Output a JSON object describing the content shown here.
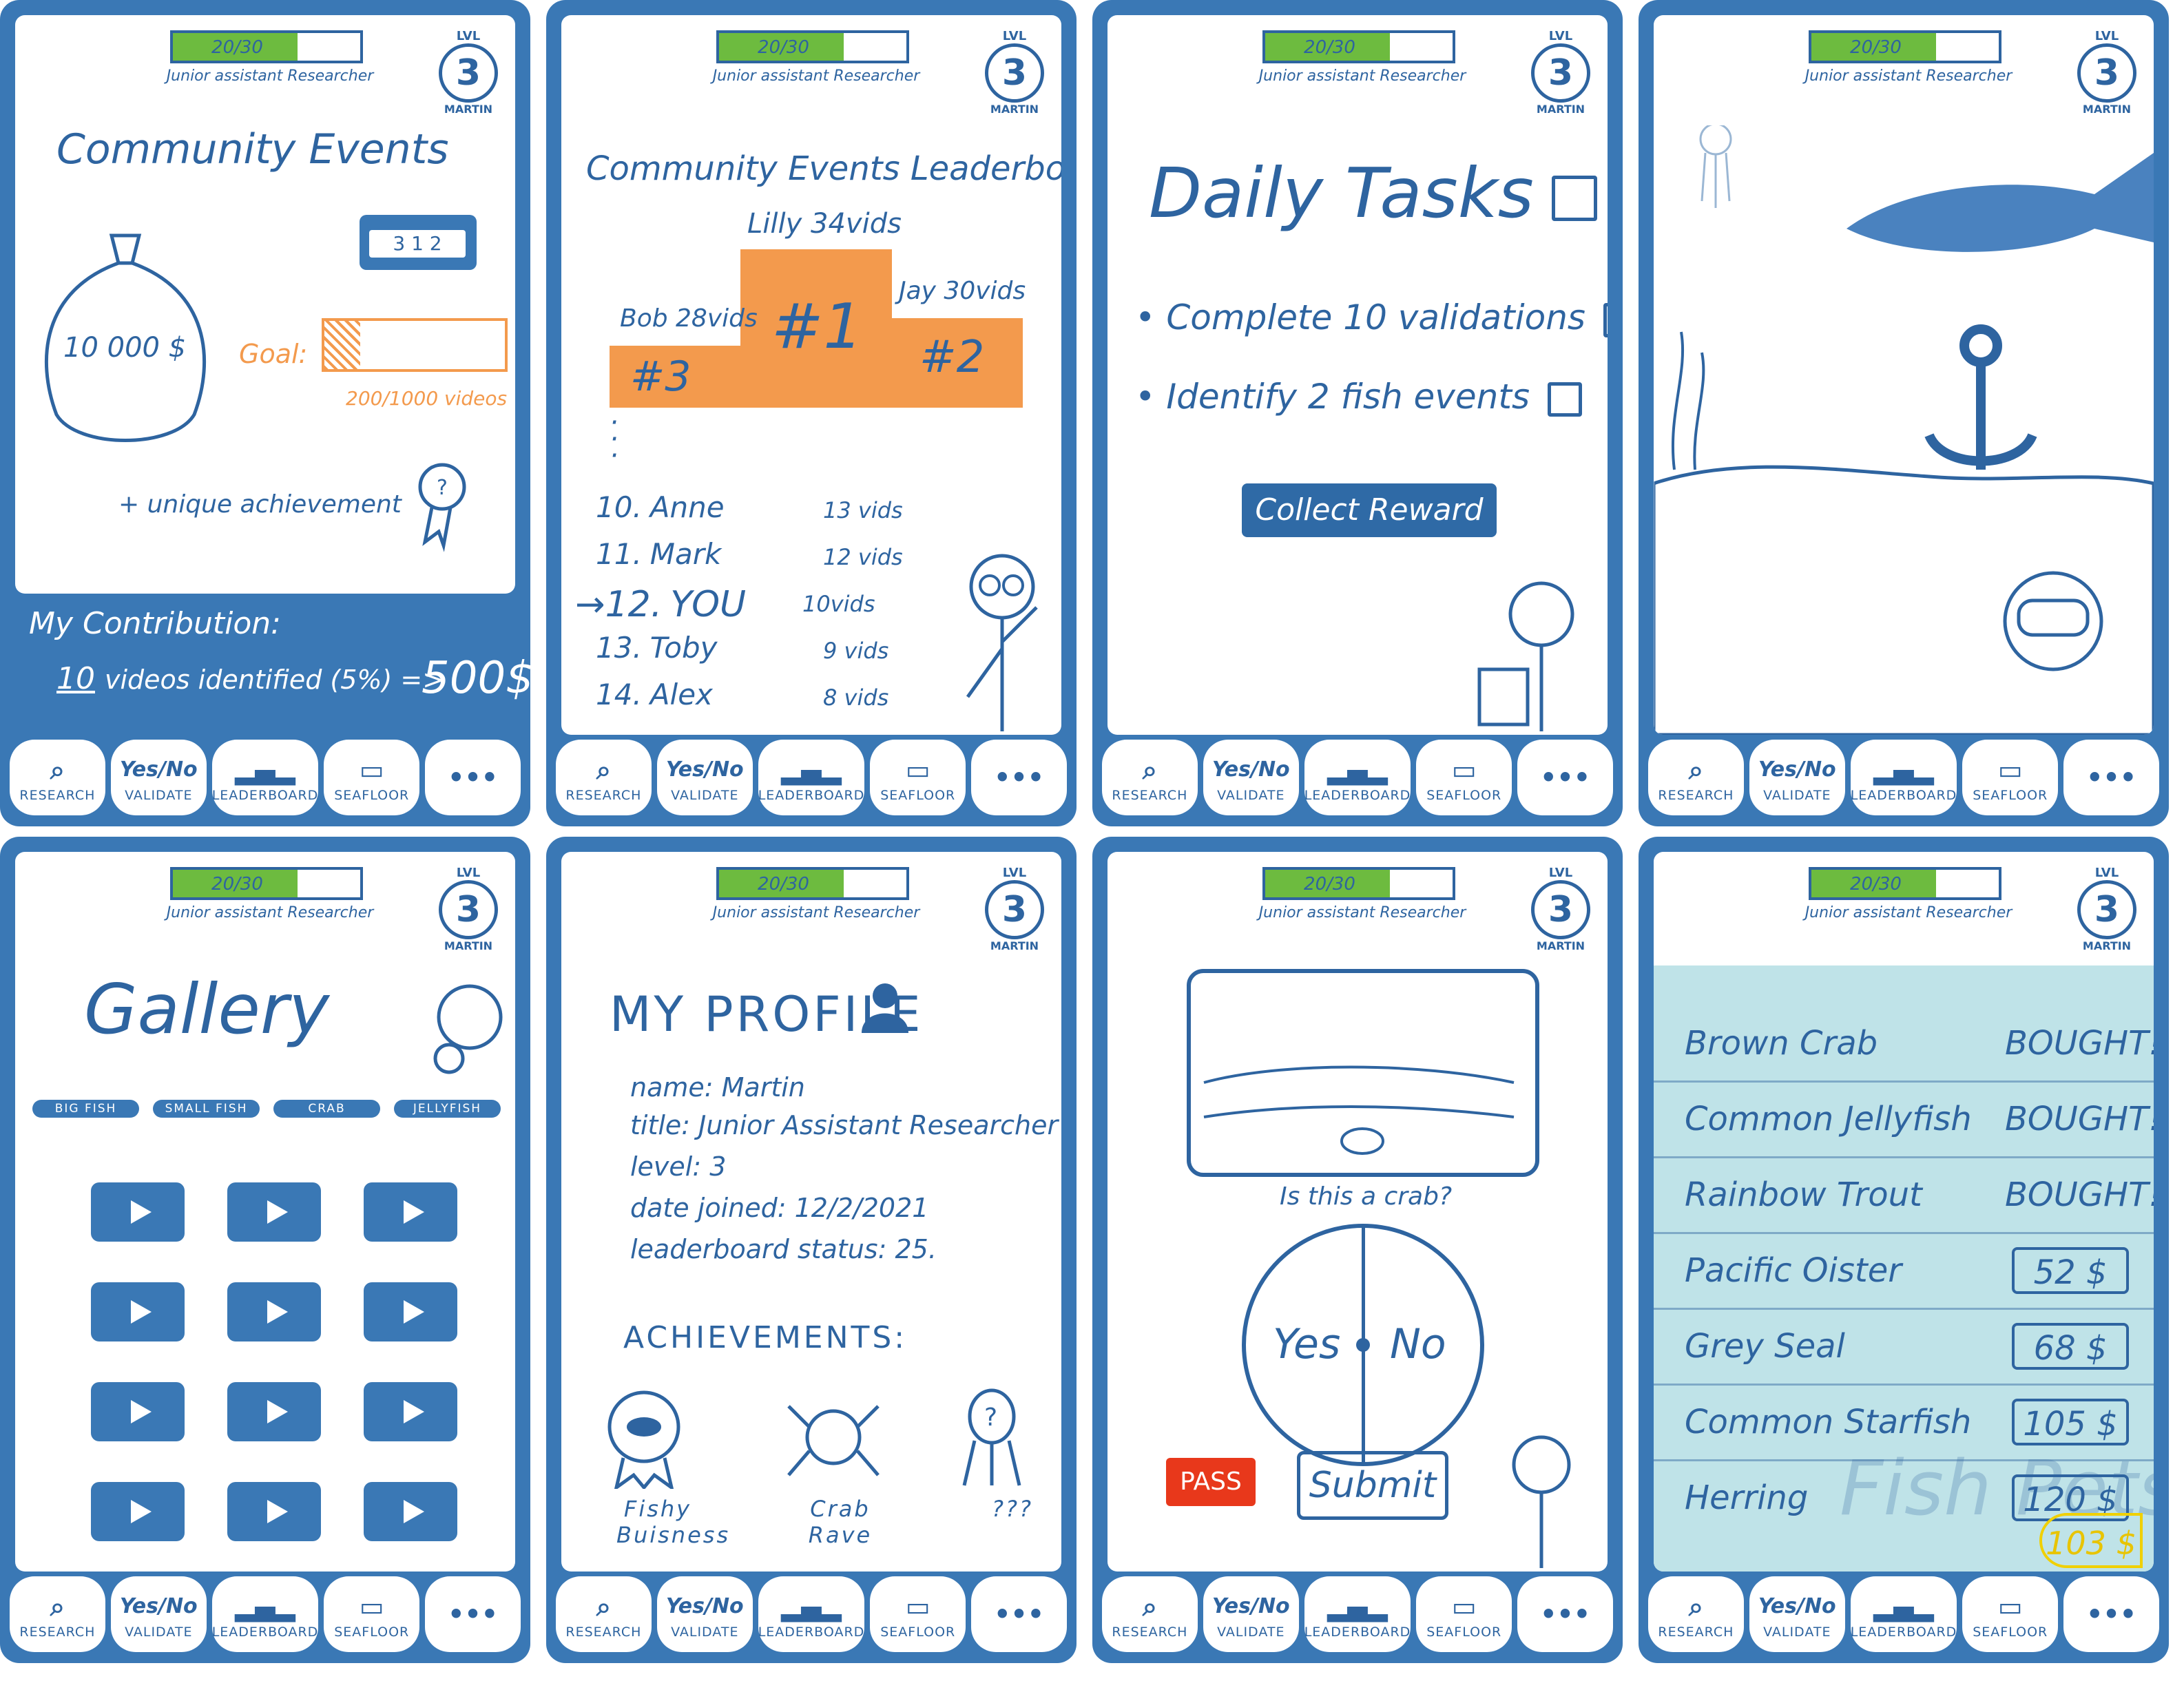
{
  "common": {
    "xp": "20/30",
    "xp_fraction": 0.667,
    "rank": "Junior assistant Researcher",
    "lvl_label": "LVL",
    "level": "3",
    "player": "MARTIN"
  },
  "nav": [
    {
      "icon": "search-icon",
      "label": "RESEARCH"
    },
    {
      "icon": "yes-no-icon",
      "label": "VALIDATE",
      "glyph": "Yes/No"
    },
    {
      "icon": "podium-icon",
      "label": "LEADERBOARD"
    },
    {
      "icon": "image-icon",
      "label": "SEAFLOOR"
    },
    {
      "icon": "more-icon",
      "label": ""
    }
  ],
  "screen1": {
    "title": "Community Events",
    "pool": "10 000 $",
    "goal_label": "Goal:",
    "goal_progress": "200/1000 videos",
    "goal_fraction": 0.2,
    "podium_badge": "3 1 2",
    "achievement": "+ unique achievement",
    "contribution_title": "My Contribution:",
    "contribution_count": "10",
    "contribution_text": "videos identified (5%) =>",
    "contribution_reward": "500$"
  },
  "screen2": {
    "title": "Community Events Leaderboard",
    "first": "Lilly 34vids",
    "first_rank": "#1",
    "second": "Jay 30vids",
    "second_rank": "#2",
    "third": "Bob 28vids",
    "third_rank": "#3",
    "rows": [
      {
        "rank": "10.",
        "name": "Anne",
        "vids": "13 vids"
      },
      {
        "rank": "11.",
        "name": "Mark",
        "vids": "12 vids"
      },
      {
        "rank": "12.",
        "name": "YOU",
        "vids": "10vids"
      },
      {
        "rank": "13.",
        "name": "Toby",
        "vids": "9 vids"
      },
      {
        "rank": "14.",
        "name": "Alex",
        "vids": "8 vids"
      }
    ]
  },
  "screen3": {
    "title": "Daily Tasks",
    "tasks": [
      "Complete 10 validations",
      "Identify 2 fish events"
    ],
    "button": "Collect Reward"
  },
  "screen5": {
    "title": "Gallery",
    "filters": [
      "BIG FISH",
      "SMALL FISH",
      "CRAB",
      "JELLYFISH"
    ]
  },
  "screen6": {
    "title": "MY PROFILE",
    "name": "name: Martin",
    "title_line": "title: Junior Assistant Researcher",
    "level": "level: 3",
    "date": "date joined: 12/2/2021",
    "status": "leaderboard status: 25.",
    "achievements_title": "ACHIEVEMENTS:",
    "achievements": [
      "Fishy Buisness",
      "Crab Rave",
      "???"
    ]
  },
  "screen7": {
    "question": "Is this a crab?",
    "yes": "Yes",
    "no": "No",
    "pass": "PASS",
    "submit": "Submit"
  },
  "screen8": {
    "items": [
      {
        "name": "Brown Crab",
        "status": "BOUGHT!"
      },
      {
        "name": "Common Jellyfish",
        "status": "BOUGHT!"
      },
      {
        "name": "Rainbow Trout",
        "status": "BOUGHT!"
      },
      {
        "name": "Pacific Oister",
        "status": "52 $"
      },
      {
        "name": "Grey Seal",
        "status": "68 $"
      },
      {
        "name": "Common Starfish",
        "status": "105 $"
      },
      {
        "name": "Herring",
        "status": "120 $"
      }
    ],
    "watermark": "Fish Pets",
    "balance": "103 $"
  }
}
